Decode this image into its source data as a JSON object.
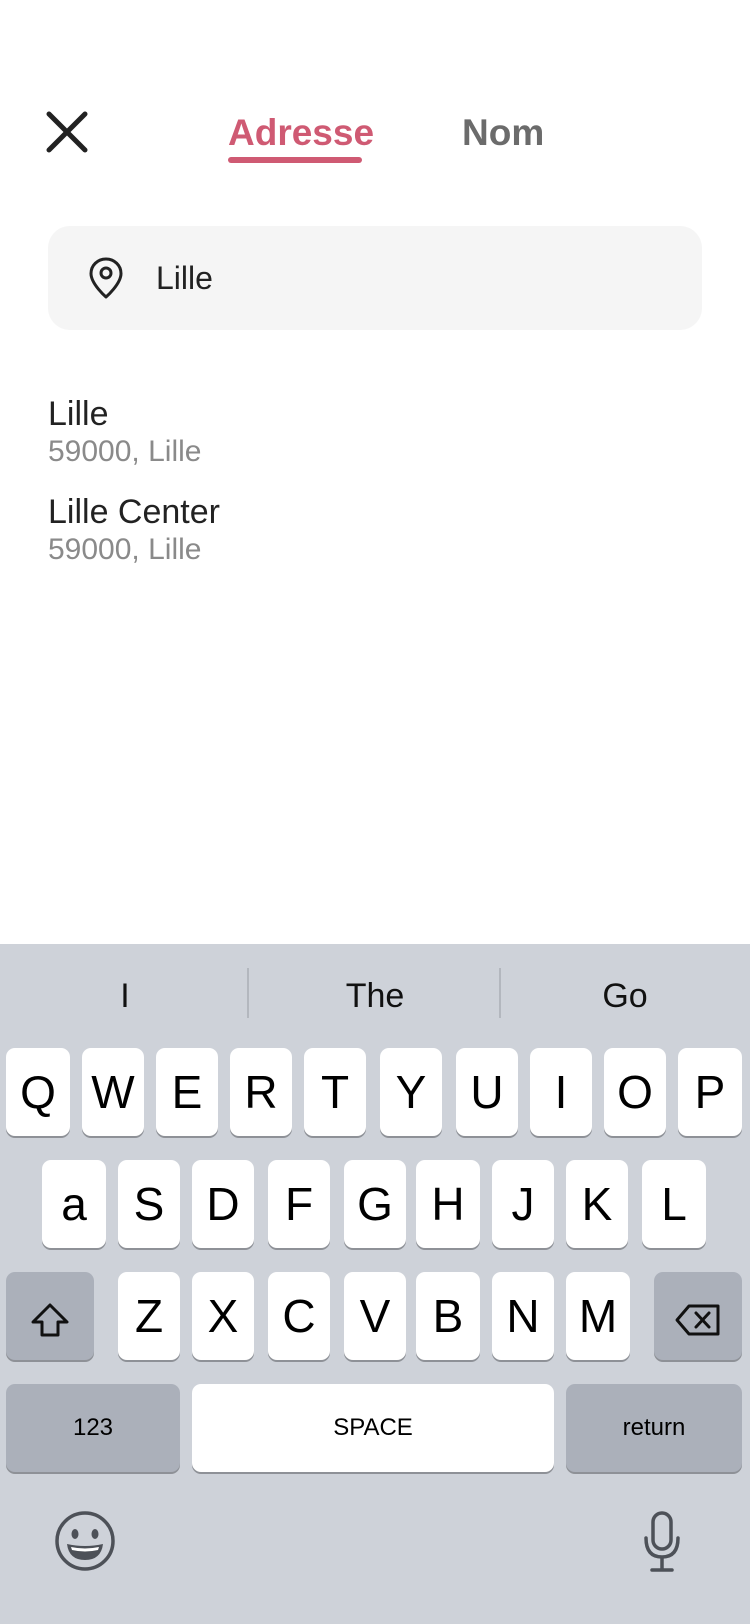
{
  "header": {
    "close_icon": "close-icon",
    "tabs": [
      {
        "label": "Adresse",
        "active": true
      },
      {
        "label": "Nom",
        "active": false
      }
    ],
    "accent_color": "#cf5a73"
  },
  "search": {
    "icon": "map-pin-icon",
    "value": "Lille"
  },
  "results": [
    {
      "title": "Lille",
      "subtitle": "59000, Lille"
    },
    {
      "title": "Lille Center",
      "subtitle": "59000, Lille"
    }
  ],
  "keyboard": {
    "suggestions": [
      "I",
      "The",
      "Go"
    ],
    "row1": [
      "Q",
      "W",
      "E",
      "R",
      "T",
      "Y",
      "U",
      "I",
      "O",
      "P"
    ],
    "row2": [
      "a",
      "S",
      "D",
      "F",
      "G",
      "H",
      "J",
      "K",
      "L"
    ],
    "row3": [
      "Z",
      "X",
      "C",
      "V",
      "B",
      "N",
      "M"
    ],
    "numbers_label": "123",
    "space_label": "SPACE",
    "return_label": "return",
    "shift_icon": "shift-icon",
    "delete_icon": "backspace-icon",
    "emoji_icon": "emoji-icon",
    "mic_icon": "microphone-icon"
  }
}
